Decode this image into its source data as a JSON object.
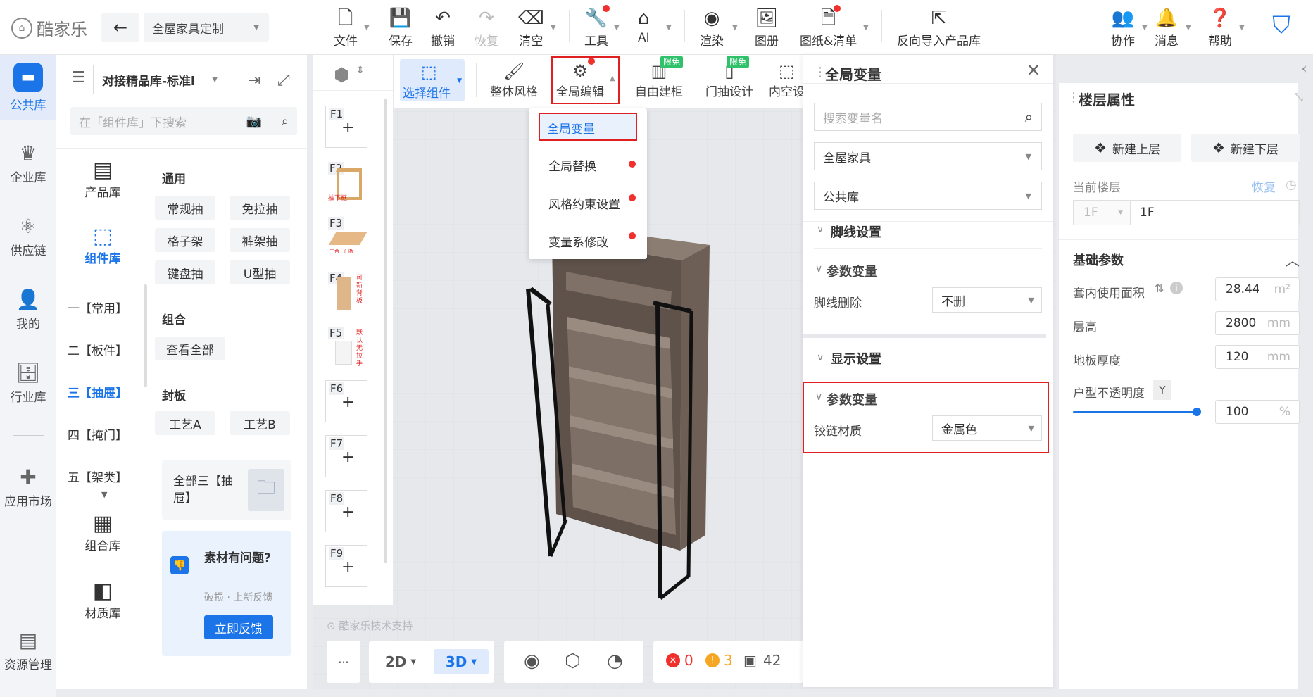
{
  "app": {
    "logo_text": "酷家乐",
    "project_title": "全屋家具定制"
  },
  "toolbar": [
    {
      "label": "文件",
      "icon": "file-icon"
    },
    {
      "label": "保存",
      "icon": "save-icon"
    },
    {
      "label": "撤销",
      "icon": "undo-icon"
    },
    {
      "label": "恢复",
      "icon": "redo-icon"
    },
    {
      "label": "清空",
      "icon": "eraser-icon"
    },
    {
      "label": "工具",
      "icon": "wrench-icon"
    },
    {
      "label": "AI",
      "icon": "ai-icon"
    },
    {
      "label": "渲染",
      "icon": "render-icon"
    },
    {
      "label": "图册",
      "icon": "album-icon"
    },
    {
      "label": "图纸&清单",
      "icon": "drawing-icon"
    },
    {
      "label": "反向导入产品库",
      "icon": "import-icon"
    },
    {
      "label": "协作",
      "icon": "users-icon"
    },
    {
      "label": "消息",
      "icon": "bell-icon"
    },
    {
      "label": "帮助",
      "icon": "help-icon"
    }
  ],
  "leftnav": [
    "公共库",
    "企业库",
    "供应链",
    "我的",
    "行业库",
    "应用市场",
    "资源管理"
  ],
  "library": {
    "selector": "对接精品库-标准l",
    "search_placeholder": "在「组件库」下搜索",
    "side": [
      "产品库",
      "组件库",
      "组合库",
      "材质库"
    ],
    "categories": [
      "一【常用】",
      "二【板件】",
      "三【抽屉】",
      "四【掩门】",
      "五【架类】"
    ],
    "sections": {
      "general": "通用",
      "combo": "组合",
      "seal": "封板"
    },
    "general_items": [
      "常规抽",
      "免拉抽",
      "格子架",
      "裤架抽",
      "键盘抽",
      "U型抽"
    ],
    "combo_items": [
      "查看全部"
    ],
    "seal_items": [
      "工艺A",
      "工艺B"
    ],
    "all_card": "全部三【抽屉】",
    "feedback": {
      "title": "素材有问题?",
      "sub": "破损 · 上新反馈",
      "button": "立即反馈"
    }
  },
  "slots": [
    "F1",
    "F2",
    "F3",
    "F4",
    "F5",
    "F6",
    "F7",
    "F8",
    "F9"
  ],
  "slot_labels": {
    "f2": "抽下框",
    "f3": "三合一门板",
    "f4": "可新背板",
    "f5": "默认无拉手"
  },
  "view_toolbar": [
    {
      "label": "选择组件"
    },
    {
      "label": "整体风格"
    },
    {
      "label": "全局编辑"
    },
    {
      "label": "自由建柜",
      "badge": "限免"
    },
    {
      "label": "门抽设计",
      "badge": "限免"
    },
    {
      "label": "内空设"
    }
  ],
  "dropdown": [
    "全局变量",
    "全局替换",
    "风格约束设置",
    "变量系修改"
  ],
  "watermark": "酷家乐技术支持",
  "bottom": {
    "mode2d": "2D",
    "mode3d": "3D",
    "errors": "0",
    "warnings": "3",
    "count": "42",
    "more": "···"
  },
  "global_var": {
    "title": "全局变量",
    "search_placeholder": "搜索变量名",
    "scope": "全屋家具",
    "lib": "公共库",
    "sec1": "脚线设置",
    "sub1": "参数变量",
    "row1_label": "脚线删除",
    "row1_value": "不删",
    "sec2": "显示设置",
    "sub2": "参数变量",
    "row2_label": "铰链材质",
    "row2_value": "金属色"
  },
  "floor": {
    "title": "楼层属性",
    "add_up": "新建上层",
    "add_down": "新建下层",
    "current_label": "当前楼层",
    "restore": "恢复",
    "floor_select": "1F",
    "floor_name": "1F",
    "basic": "基础参数",
    "area_label": "套内使用面积",
    "area_value": "28.44",
    "area_unit": "m²",
    "height_label": "层高",
    "height_value": "2800",
    "thick_label": "地板厚度",
    "thick_value": "120",
    "mm": "mm",
    "opacity_label": "户型不透明度",
    "opacity_key": "Y",
    "opacity_value": "100",
    "pct": "%"
  },
  "colors": {
    "accent": "#1b74e8",
    "alert": "#e02020",
    "badge": "#2fc26b"
  }
}
